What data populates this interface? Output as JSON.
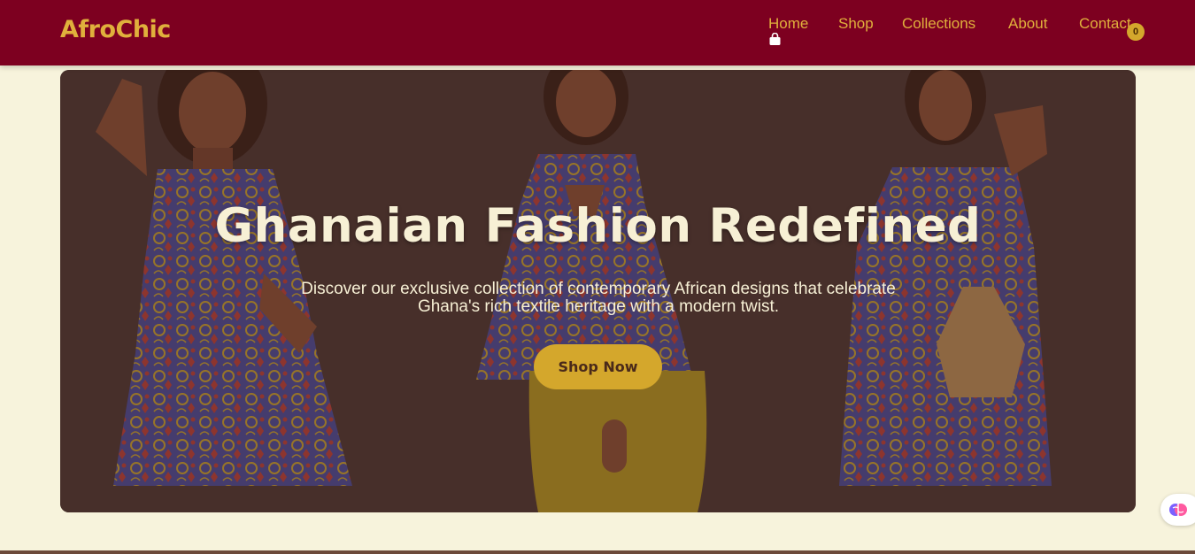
{
  "header": {
    "logo": "AfroChic",
    "nav": [
      "Home",
      "Shop",
      "Collections",
      "About",
      "Contact"
    ],
    "cart_count": "0"
  },
  "hero": {
    "title": "Ghanaian Fashion Redefined",
    "subtitle": "Discover our exclusive collection of contemporary African designs that celebrate Ghana's rich textile heritage with a modern twist.",
    "cta": "Shop Now"
  },
  "colors": {
    "navbar": "#7d0020",
    "accent": "#e0b03c",
    "button": "#d4a72c",
    "page_bg": "#f7f3dc"
  },
  "icons": {
    "cart": "shopping-bag-icon",
    "assistant": "brain-icon"
  }
}
